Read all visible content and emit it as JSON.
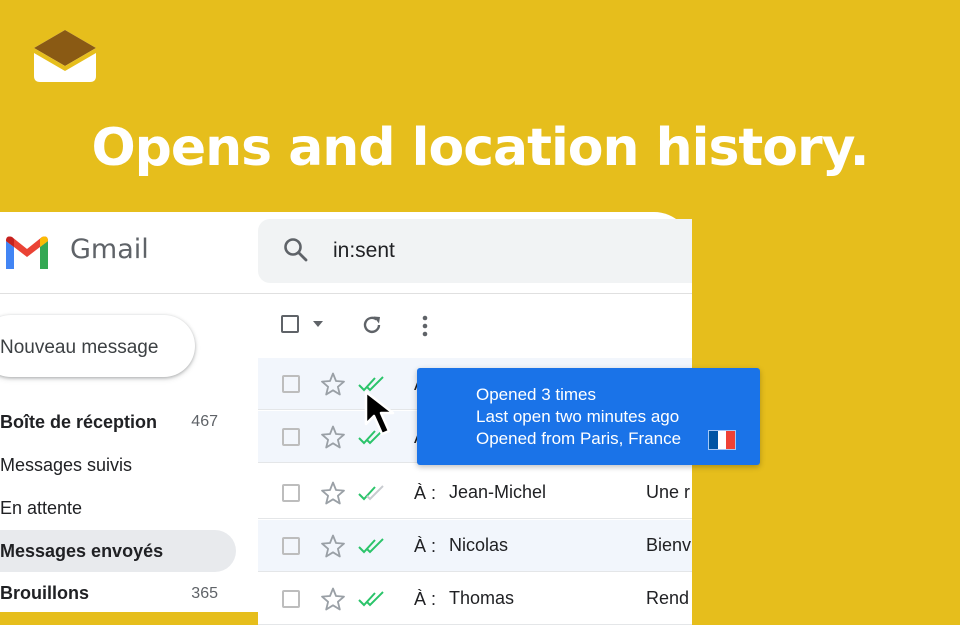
{
  "headline": "Opens and location history.",
  "brand": {
    "accent": "#e6be1c",
    "tooltip_bg": "#1a73e8"
  },
  "gmail": {
    "wordmark": "Gmail"
  },
  "search": {
    "query": "in:sent"
  },
  "compose": {
    "label": "Nouveau message"
  },
  "sidebar": {
    "items": [
      {
        "label": "Boîte de réception",
        "count": "467",
        "bold": true
      },
      {
        "label": "Messages suivis",
        "count": ""
      },
      {
        "label": "En attente",
        "count": ""
      },
      {
        "label": "Messages envoyés",
        "count": "",
        "active": true
      },
      {
        "label": "Brouillons",
        "count": "365",
        "bold": true
      }
    ]
  },
  "toolbar": {
    "icons": [
      "checkbox-icon",
      "chevron-down-icon",
      "refresh-icon",
      "more-vert-icon"
    ]
  },
  "rows": [
    {
      "to": "À :",
      "name": "",
      "snippet": "",
      "ticks": "both-green"
    },
    {
      "to": "À :",
      "name": "",
      "snippet": "",
      "ticks": "both-green"
    },
    {
      "to": "À :",
      "name": "Jean-Michel",
      "snippet": "Une r",
      "ticks": "one-green"
    },
    {
      "to": "À :",
      "name": "Nicolas",
      "snippet": "Bienv",
      "ticks": "both-green"
    },
    {
      "to": "À :",
      "name": "Thomas",
      "snippet": "Rend",
      "ticks": "both-green"
    }
  ],
  "tooltip": {
    "line1": "Opened 3 times",
    "line2": "Last open two minutes ago",
    "line3": "Opened from Paris, France",
    "flag_colors": [
      "#0055a4",
      "#ffffff",
      "#ef4135"
    ]
  }
}
